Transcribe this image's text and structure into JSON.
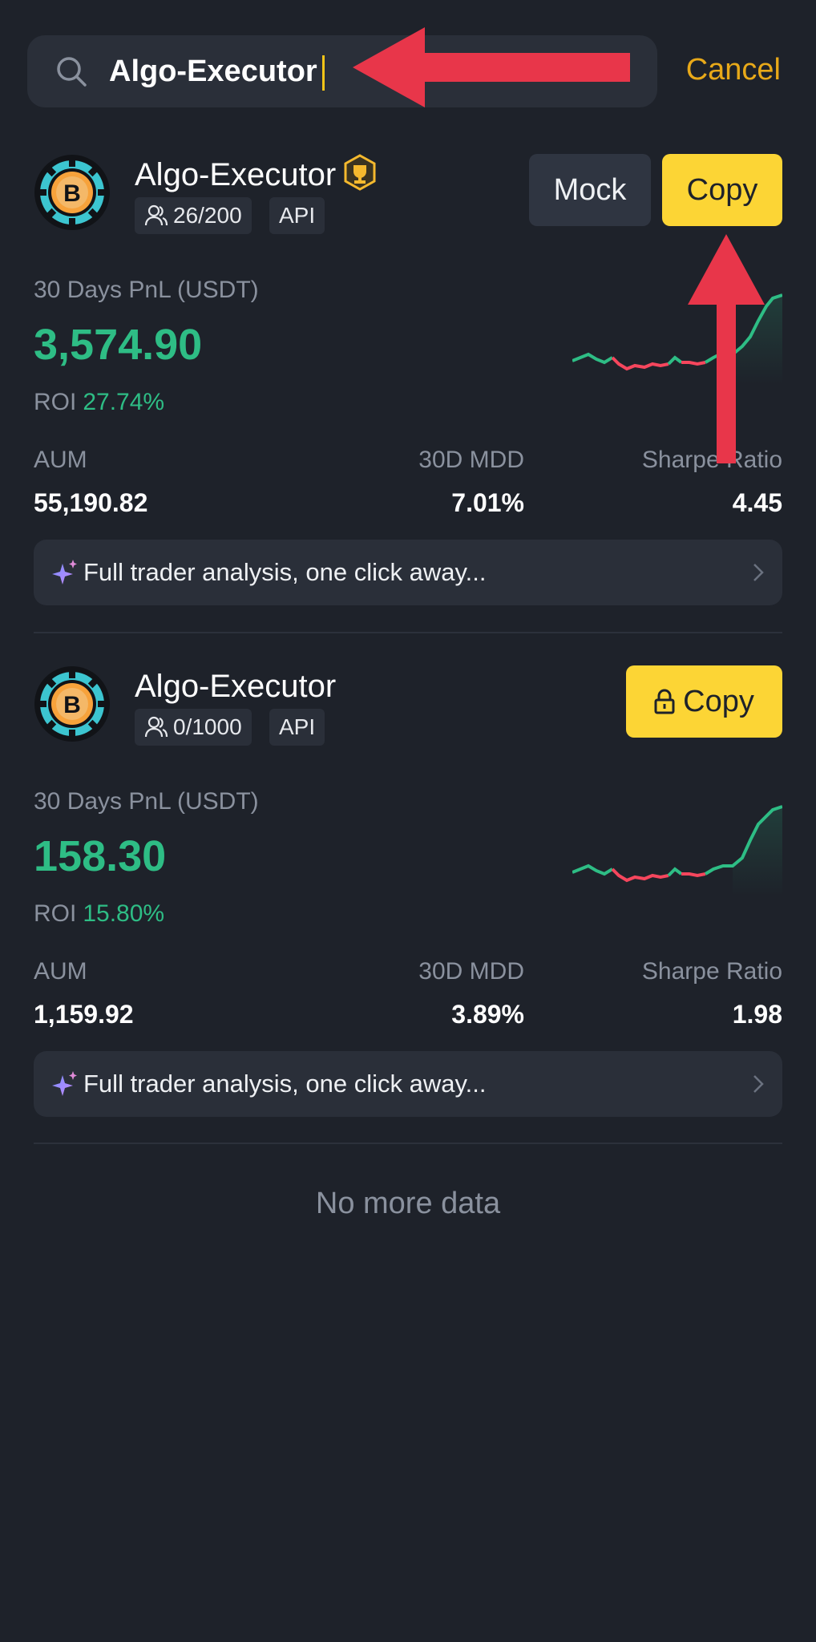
{
  "search": {
    "value": "Algo-Executor",
    "cancel_label": "Cancel"
  },
  "traders": [
    {
      "name": "Algo-Executor",
      "followers": "26/200",
      "tag": "API",
      "mock_label": "Mock",
      "copy_label": "Copy",
      "pnl_label": "30 Days PnL (USDT)",
      "pnl_value": "3,574.90",
      "roi_label": "ROI",
      "roi_value": "27.74%",
      "aum_label": "AUM",
      "aum_value": "55,190.82",
      "mdd_label": "30D MDD",
      "mdd_value": "7.01%",
      "sharpe_label": "Sharpe Ratio",
      "sharpe_value": "4.45",
      "analysis_text": "Full trader analysis, one click away..."
    },
    {
      "name": "Algo-Executor",
      "followers": "0/1000",
      "tag": "API",
      "copy_label": "Copy",
      "pnl_label": "30 Days PnL (USDT)",
      "pnl_value": "158.30",
      "roi_label": "ROI",
      "roi_value": "15.80%",
      "aum_label": "AUM",
      "aum_value": "1,159.92",
      "mdd_label": "30D MDD",
      "mdd_value": "3.89%",
      "sharpe_label": "Sharpe Ratio",
      "sharpe_value": "1.98",
      "analysis_text": "Full trader analysis, one click away..."
    }
  ],
  "footer": {
    "no_more": "No more data"
  },
  "colors": {
    "background": "#1e222a",
    "accent_yellow": "#fcd535",
    "cancel_yellow": "#e8a919",
    "positive_green": "#2ebd85",
    "negative_red": "#f6465d",
    "annotation_red": "#e8364a"
  },
  "icons": [
    "search-icon",
    "clear-icon",
    "bitcoin-avatar",
    "trophy-icon",
    "people-icon",
    "lock-icon",
    "sparkle-icon",
    "chevron-right-icon"
  ]
}
